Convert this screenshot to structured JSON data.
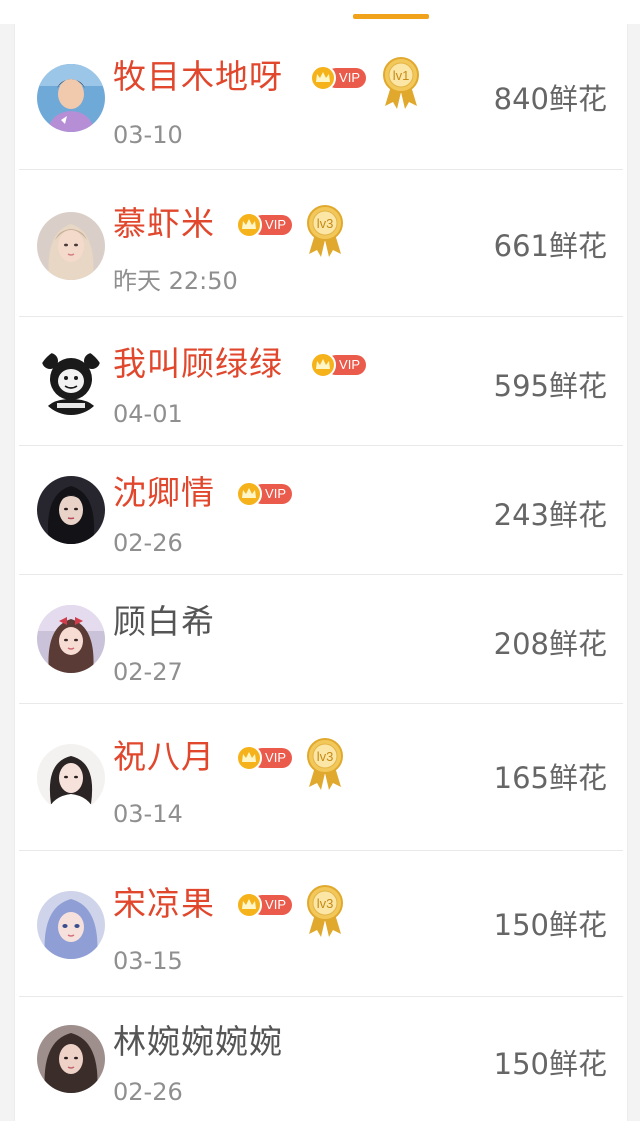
{
  "tab_indicator_color": "#f0a21a",
  "vip_name_color": "#e0472c",
  "rows": [
    {
      "name": "牧目木地呀",
      "date": "03-10",
      "amount": "840鲜花",
      "vip": true,
      "vip_label": "VIP",
      "level": "lv1",
      "avatar": "boy-purple-shirt-avatar"
    },
    {
      "name": "慕虾米",
      "date": "昨天 22:50",
      "amount": "661鲜花",
      "vip": true,
      "vip_label": "VIP",
      "level": "lv3",
      "avatar": "girl-portrait-avatar"
    },
    {
      "name": "我叫顾绿绿",
      "date": "04-01",
      "amount": "595鲜花",
      "vip": true,
      "vip_label": "VIP",
      "level": "",
      "avatar": "cartoon-face-avatar"
    },
    {
      "name": "沈卿情",
      "date": "02-26",
      "amount": "243鲜花",
      "vip": true,
      "vip_label": "VIP",
      "level": "",
      "avatar": "dark-girl-avatar"
    },
    {
      "name": "顾白希",
      "date": "02-27",
      "amount": "208鲜花",
      "vip": false,
      "vip_label": "",
      "level": "",
      "avatar": "girl-bow-avatar"
    },
    {
      "name": "祝八月",
      "date": "03-14",
      "amount": "165鲜花",
      "vip": true,
      "vip_label": "VIP",
      "level": "lv3",
      "avatar": "girl-white-avatar"
    },
    {
      "name": "宋凉果",
      "date": "03-15",
      "amount": "150鲜花",
      "vip": true,
      "vip_label": "VIP",
      "level": "lv3",
      "avatar": "blue-hair-girl-avatar"
    },
    {
      "name": "林婉婉婉婉",
      "date": "02-26",
      "amount": "150鲜花",
      "vip": false,
      "vip_label": "",
      "level": "",
      "avatar": "girl-long-hair-avatar"
    }
  ]
}
